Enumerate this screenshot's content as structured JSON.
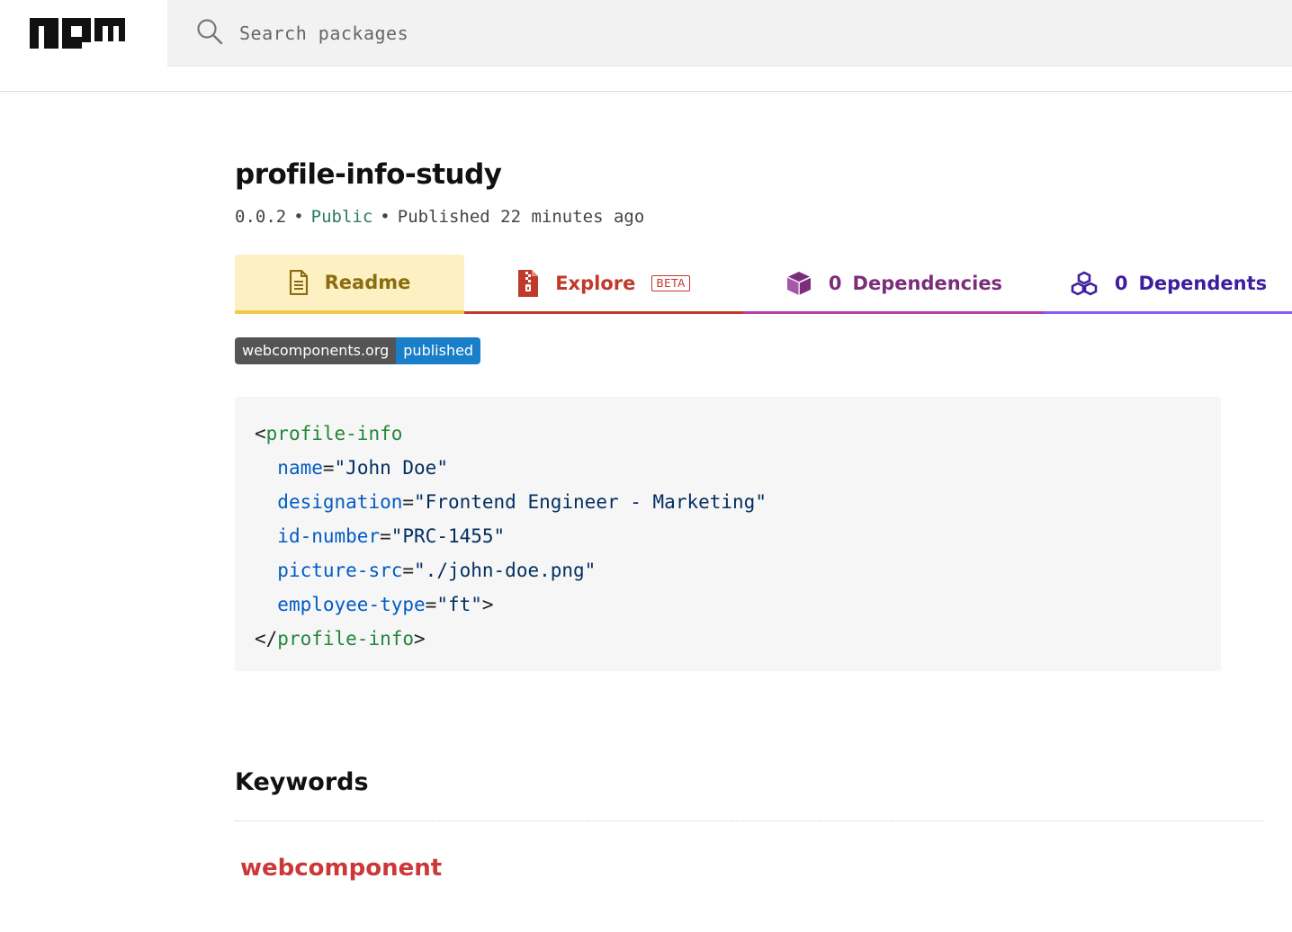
{
  "header": {
    "logo_icon": "npm-logo-icon",
    "search": {
      "placeholder": "Search packages",
      "value": ""
    }
  },
  "package": {
    "name": "profile-info-study",
    "version": "0.0.2",
    "visibility": "Public",
    "published": "Published 22 minutes ago",
    "separator": "•"
  },
  "tabs": [
    {
      "label": "Readme",
      "icon": "file-text-icon",
      "count": "",
      "active": true
    },
    {
      "label": "Explore",
      "icon": "zip-file-icon",
      "badge": "BETA",
      "count": ""
    },
    {
      "label": "Dependencies",
      "icon": "box-icon",
      "count": "0"
    },
    {
      "label": "Dependents",
      "icon": "boxes-icon",
      "count": "0"
    }
  ],
  "badge": {
    "left": "webcomponents.org",
    "right": "published"
  },
  "code": {
    "lines": [
      [
        {
          "t": "punc",
          "v": "<"
        },
        {
          "t": "tag",
          "v": "profile-info"
        }
      ],
      [
        {
          "t": "punc",
          "v": "  "
        },
        {
          "t": "attr",
          "v": "name"
        },
        {
          "t": "punc",
          "v": "="
        },
        {
          "t": "str",
          "v": "\"John Doe\""
        }
      ],
      [
        {
          "t": "punc",
          "v": "  "
        },
        {
          "t": "attr",
          "v": "designation"
        },
        {
          "t": "punc",
          "v": "="
        },
        {
          "t": "str",
          "v": "\"Frontend Engineer - Marketing\""
        }
      ],
      [
        {
          "t": "punc",
          "v": "  "
        },
        {
          "t": "attr",
          "v": "id-number"
        },
        {
          "t": "punc",
          "v": "="
        },
        {
          "t": "str",
          "v": "\"PRC-1455\""
        }
      ],
      [
        {
          "t": "punc",
          "v": "  "
        },
        {
          "t": "attr",
          "v": "picture-src"
        },
        {
          "t": "punc",
          "v": "="
        },
        {
          "t": "str",
          "v": "\"./john-doe.png\""
        }
      ],
      [
        {
          "t": "punc",
          "v": "  "
        },
        {
          "t": "attr",
          "v": "employee-type"
        },
        {
          "t": "punc",
          "v": "="
        },
        {
          "t": "str",
          "v": "\"ft\""
        },
        {
          "t": "punc",
          "v": ">"
        }
      ],
      [
        {
          "t": "punc",
          "v": "</"
        },
        {
          "t": "tag",
          "v": "profile-info"
        },
        {
          "t": "punc",
          "v": ">"
        }
      ]
    ]
  },
  "keywords": {
    "title": "Keywords",
    "items": [
      "webcomponent"
    ]
  },
  "colors": {
    "npm_red": "#cb3837",
    "readme_bg": "#fdf0c2",
    "explore": "#c0392b",
    "dependencies": "#b43fa8",
    "dependents": "#8a5cf0"
  }
}
